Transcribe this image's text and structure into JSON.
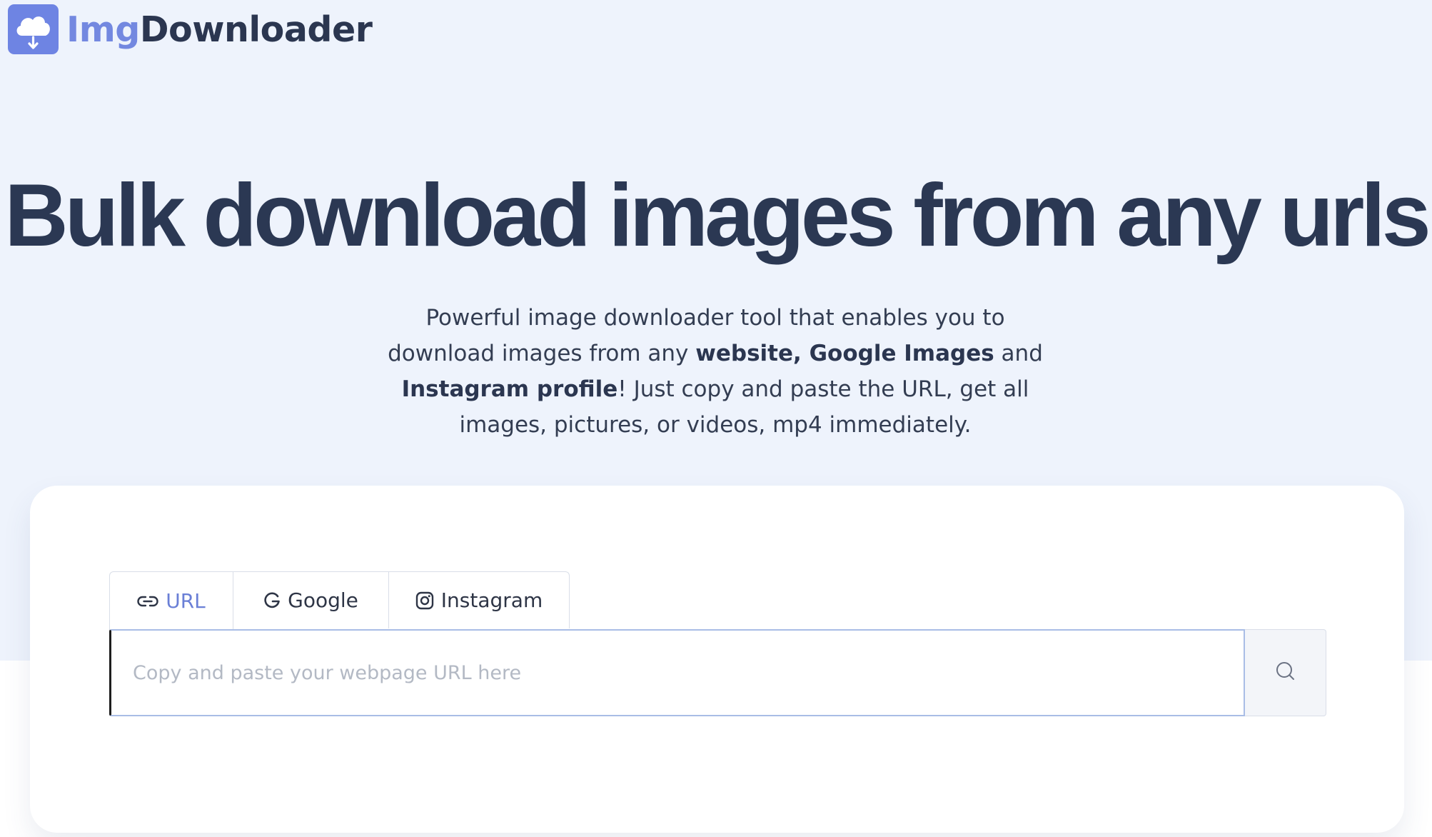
{
  "brand": {
    "name_part1": "Img",
    "name_part2": "Downloader",
    "accent_color": "#6e84e3",
    "logo_icon": "cloud-download-icon"
  },
  "hero": {
    "headline": "Bulk download images from any urls",
    "subtitle": {
      "part1": "Powerful image downloader tool that enables you to download images from any ",
      "bold1": "website, Google Images",
      "part2": " and ",
      "bold2": "Instagram profile",
      "part3": "! Just copy and paste the URL, get all images, pictures, or videos, mp4 immediately."
    }
  },
  "tabs": [
    {
      "label": "URL",
      "icon": "link-icon",
      "active": true
    },
    {
      "label": "Google",
      "icon": "google-icon",
      "active": false
    },
    {
      "label": "Instagram",
      "icon": "instagram-icon",
      "active": false
    }
  ],
  "search": {
    "placeholder": "Copy and paste your webpage URL here",
    "value": "",
    "button_icon": "search-icon"
  },
  "colors": {
    "hero_background": "#eef3fc",
    "headline": "#2b3853",
    "active_tab": "#6a7fd6"
  }
}
